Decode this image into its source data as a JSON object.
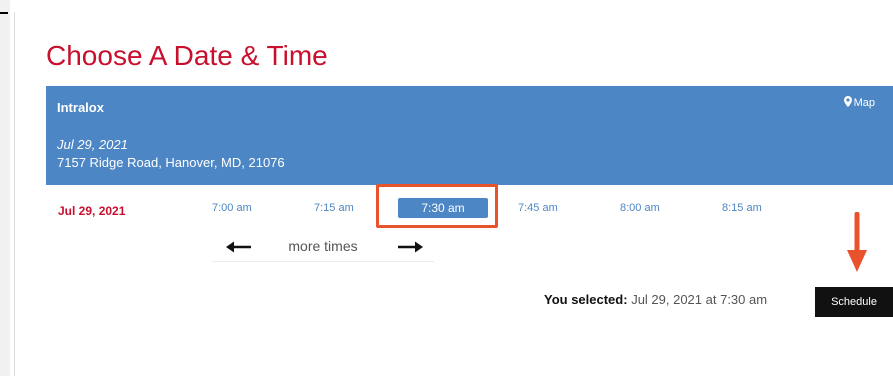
{
  "header": {
    "title": "Choose A Date & Time"
  },
  "location": {
    "name": "Intralox",
    "map_label": "Map",
    "date": "Jul 29, 2021",
    "address": "7157 Ridge Road, Hanover, MD, 21076"
  },
  "times": {
    "date_label": "Jul 29, 2021",
    "slots": [
      "7:00 am",
      "7:15 am",
      "7:30 am",
      "7:45 am",
      "8:00 am",
      "8:15 am"
    ],
    "selected_index": 2,
    "more_label": "more times"
  },
  "selection": {
    "label": "You selected:",
    "value": "Jul 29, 2021 at 7:30 am"
  },
  "actions": {
    "schedule_label": "Schedule"
  },
  "icons": {
    "map": "map-marker-icon",
    "prev": "arrow-left-icon",
    "next": "arrow-right-icon",
    "hint": "arrow-down-icon"
  },
  "colors": {
    "accent_red": "#c8102e",
    "panel_blue": "#4d86c4",
    "highlight_orange": "#e8532c",
    "button_black": "#111111"
  }
}
